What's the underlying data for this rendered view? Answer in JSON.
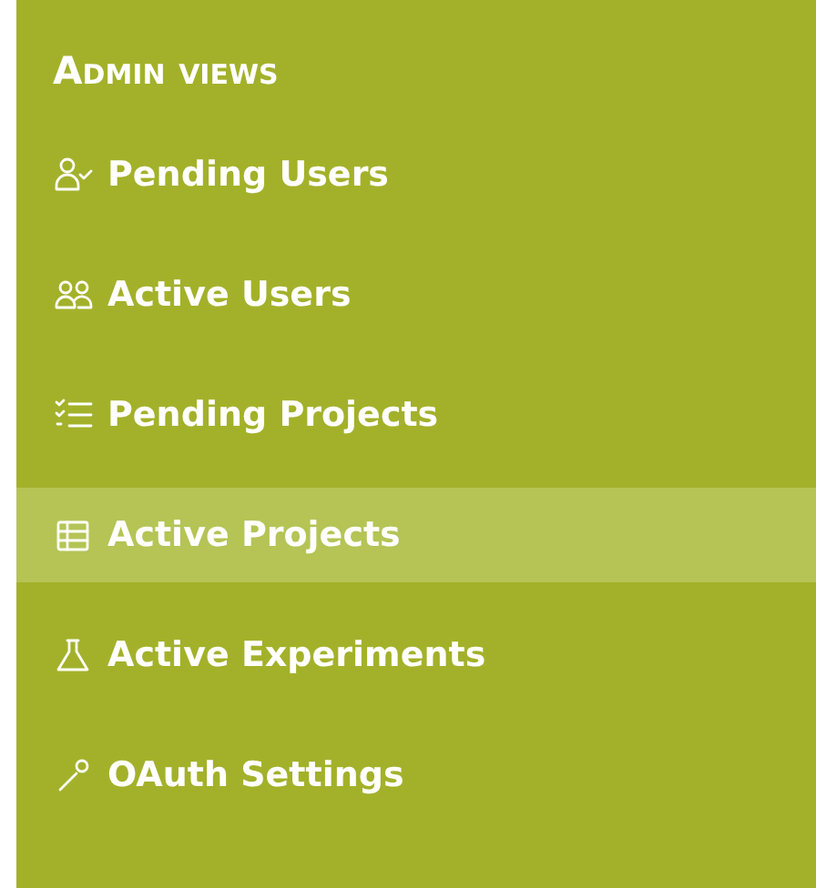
{
  "sidebar": {
    "heading": "Admin views",
    "items": [
      {
        "label": "Pending Users",
        "selected": false
      },
      {
        "label": "Active Users",
        "selected": false
      },
      {
        "label": "Pending Projects",
        "selected": false
      },
      {
        "label": "Active Projects",
        "selected": true
      },
      {
        "label": "Active Experiments",
        "selected": false
      },
      {
        "label": "OAuth Settings",
        "selected": false
      }
    ]
  }
}
